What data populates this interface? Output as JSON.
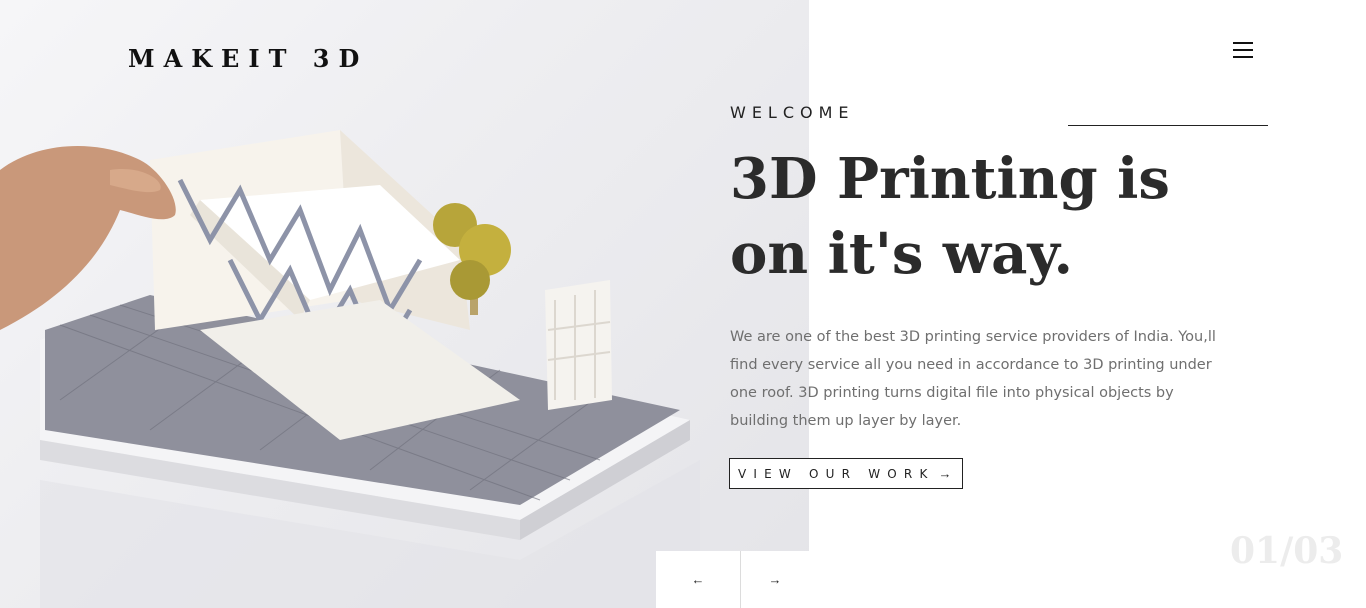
{
  "brand": {
    "name": "MAKEIT 3D"
  },
  "header": {
    "menu_icon": "hamburger-menu-icon"
  },
  "hero": {
    "eyebrow": "WELCOME",
    "title_line1": "3D Printing is",
    "title_line2": "on it's way.",
    "description": "We are one of the best 3D printing service providers of India. You,ll find every service all you need in accordance to 3D printing under one roof. 3D printing turns digital file into physical objects by building them up layer by layer.",
    "cta_label": "VIEW OUR WORK",
    "cta_icon": "arrow-right-icon",
    "image_icon": "architectural-3d-model-image"
  },
  "slider": {
    "counter": "01/03",
    "prev_icon": "arrow-left-icon",
    "next_icon": "arrow-right-icon",
    "prev_glyph": "🡠",
    "next_glyph": "🡢"
  },
  "colors": {
    "text_dark": "#2b2b2b",
    "text_body": "#6f6f6f",
    "counter": "#ececec",
    "background": "#ffffff"
  }
}
